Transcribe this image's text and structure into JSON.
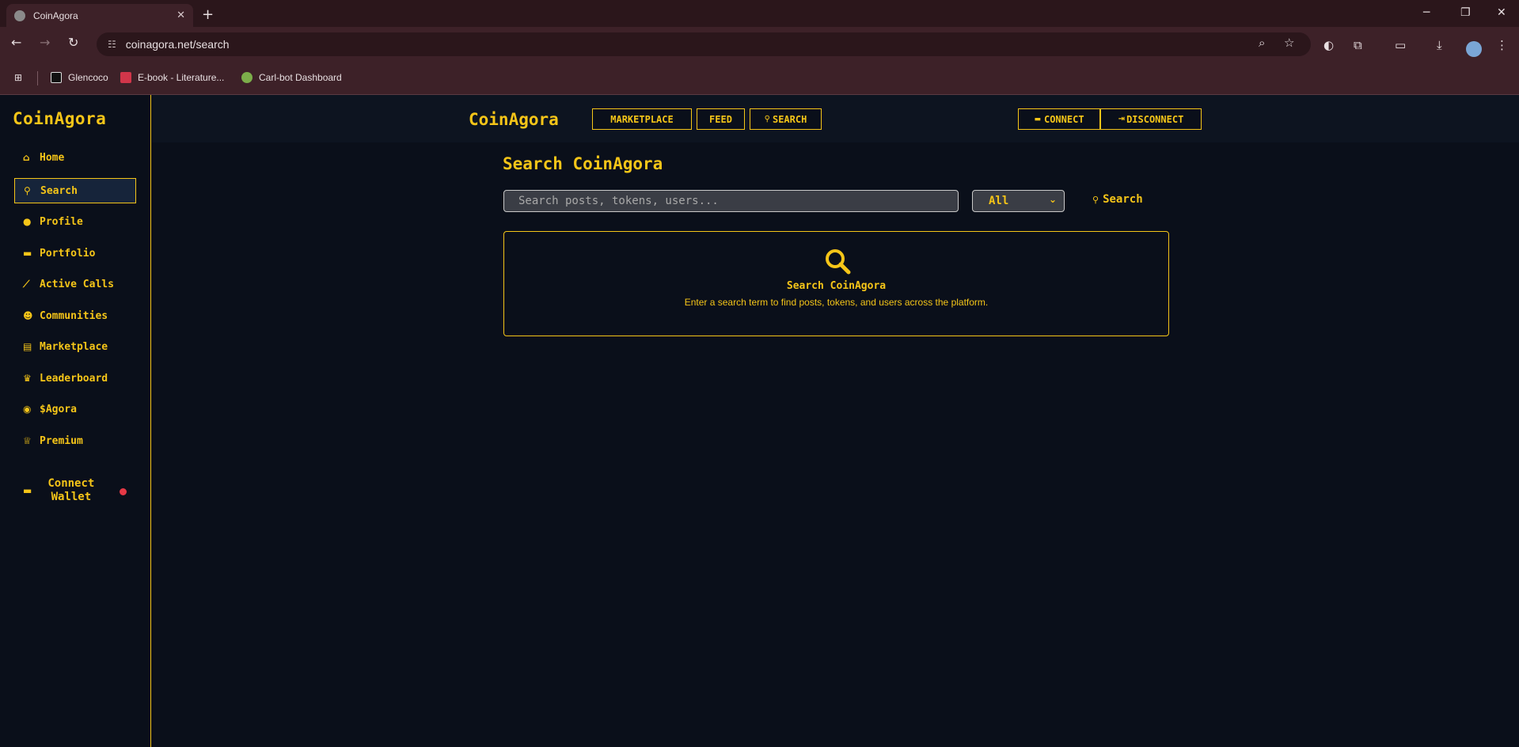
{
  "browser": {
    "tab_title": "CoinAgora",
    "url": "coinagora.net/search",
    "bookmarks": [
      {
        "label": "Glencoco"
      },
      {
        "label": "E-book - Literature..."
      },
      {
        "label": "Carl-bot Dashboard"
      }
    ]
  },
  "sidebar": {
    "logo": "CoinAgora",
    "items": [
      {
        "label": "Home",
        "icon": "home-icon"
      },
      {
        "label": "Search",
        "icon": "search-icon"
      },
      {
        "label": "Profile",
        "icon": "user-icon"
      },
      {
        "label": "Portfolio",
        "icon": "wallet-icon"
      },
      {
        "label": "Active Calls",
        "icon": "chart-line-icon"
      },
      {
        "label": "Communities",
        "icon": "users-icon"
      },
      {
        "label": "Marketplace",
        "icon": "store-icon"
      },
      {
        "label": "Leaderboard",
        "icon": "trophy-icon"
      },
      {
        "label": "$Agora",
        "icon": "coins-icon"
      },
      {
        "label": "Premium",
        "icon": "crown-icon"
      }
    ],
    "active_item": "Search",
    "wallet_line1": "Connect",
    "wallet_line2": "Wallet"
  },
  "topnav": {
    "brand": "CoinAgora",
    "marketplace": "MARKETPLACE",
    "feed": "FEED",
    "search": "SEARCH",
    "connect": "CONNECT",
    "disconnect": "DISCONNECT"
  },
  "main": {
    "title": "Search CoinAgora",
    "search_placeholder": "Search posts, tokens, users...",
    "filter_value": "All",
    "search_button": "Search",
    "empty_title": "Search CoinAgora",
    "empty_description": "Enter a search term to find posts, tokens, and users across the platform."
  },
  "colors": {
    "accent": "#f5c518",
    "background": "#0a0f1a",
    "status_dot": "#e63946"
  }
}
